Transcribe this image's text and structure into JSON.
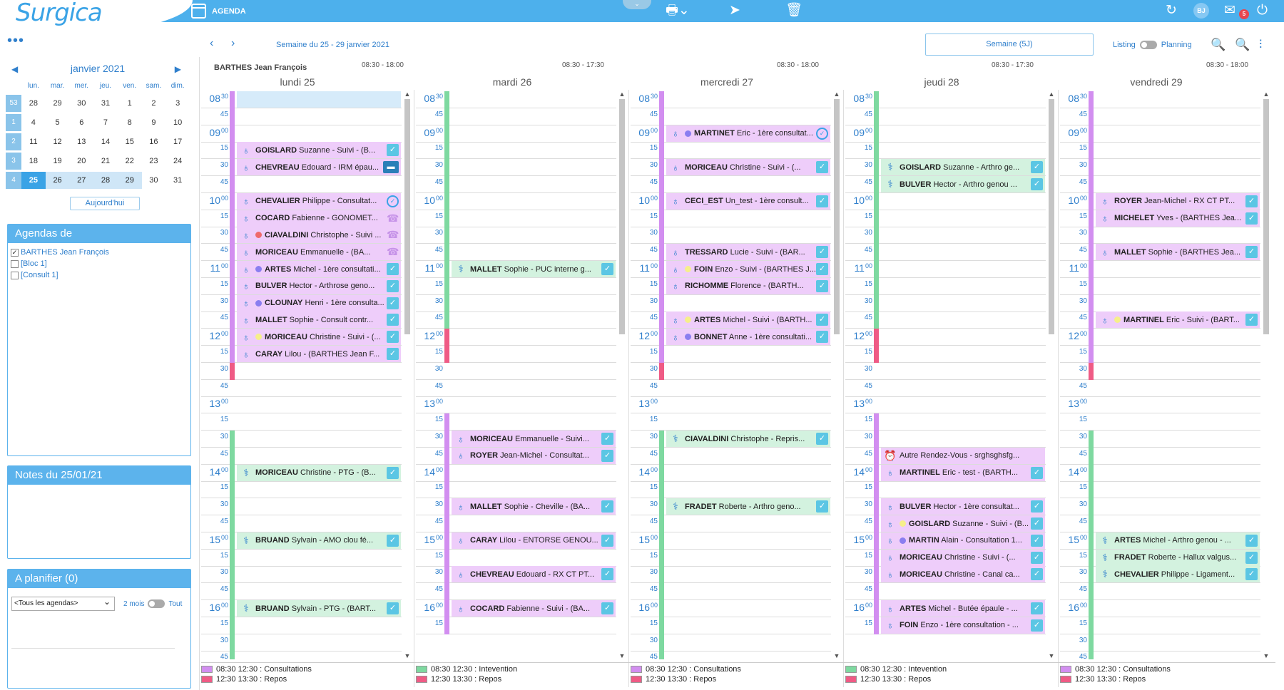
{
  "topbar": {
    "logo": "Surgica",
    "agenda_label": "AGENDA",
    "avatar": "BJ",
    "mail_count": "5",
    "icons": [
      "calendar-icon",
      "print-icon",
      "send-icon",
      "trash-icon",
      "refresh-icon",
      "mail-icon",
      "logout-icon"
    ]
  },
  "week_label": "Semaine du 25 - 29 janvier 2021",
  "week_button": "Semaine (5J)",
  "listing_label": "Listing",
  "planning_label": "Planning",
  "doctor": "BARTHES Jean François",
  "mini_cal": {
    "month": "janvier 2021",
    "dow": [
      "lun.",
      "mar.",
      "mer.",
      "jeu.",
      "ven.",
      "sam.",
      "dim."
    ],
    "weeks": [
      {
        "n": "53",
        "d": [
          "28",
          "29",
          "30",
          "31",
          "1",
          "2",
          "3"
        ]
      },
      {
        "n": "1",
        "d": [
          "4",
          "5",
          "6",
          "7",
          "8",
          "9",
          "10"
        ]
      },
      {
        "n": "2",
        "d": [
          "11",
          "12",
          "13",
          "14",
          "15",
          "16",
          "17"
        ]
      },
      {
        "n": "3",
        "d": [
          "18",
          "19",
          "20",
          "21",
          "22",
          "23",
          "24"
        ]
      },
      {
        "n": "4",
        "d": [
          "25",
          "26",
          "27",
          "28",
          "29",
          "30",
          "31"
        ]
      }
    ],
    "today_btn": "Aujourd'hui"
  },
  "agendas": {
    "title": "Agendas de",
    "items": [
      {
        "label": "BARTHES Jean François",
        "checked": true
      },
      {
        "label": "[Bloc 1]",
        "checked": false
      },
      {
        "label": "[Consult 1]",
        "checked": false
      }
    ]
  },
  "notes": {
    "title": "Notes du 25/01/21"
  },
  "planifier": {
    "title": "A planifier",
    "count": "(0)",
    "select": "<Tous les agendas>",
    "period": "2 mois",
    "all": "Tout"
  },
  "colors": {
    "consult": "#d28ef0",
    "interv": "#7ed9a0",
    "repos": "#ef5b85"
  },
  "days": [
    {
      "hours": "08:30 - 18:00",
      "title": "lundi 25",
      "legend": [
        {
          "c": "#d28ef0",
          "t": "08:30 12:30 : Consultations"
        },
        {
          "c": "#ef5b85",
          "t": "12:30 13:30 : Repos"
        }
      ],
      "end": "17:30",
      "appts": [
        {
          "t": "09:15",
          "name": "GOISLARD",
          "rest": " Suzanne - Suivi -  (B...",
          "st": "✓",
          "kind": "c"
        },
        {
          "t": "09:30",
          "name": "CHEVREAU",
          "rest": " Edouard - IRM épau...",
          "st": "▬",
          "stk": "card",
          "kind": "c"
        },
        {
          "t": "10:00",
          "name": "CHEVALIER",
          "rest": " Philippe - Consultat...",
          "st": "✓",
          "stk": "arr",
          "kind": "c"
        },
        {
          "t": "10:15",
          "name": "COCARD",
          "rest": " Fabienne - GONOMET...",
          "st": "☎",
          "stk": "phone",
          "kind": "c"
        },
        {
          "t": "10:30",
          "name": "CIAVALDINI",
          "rest": " Christophe - Suivi ...",
          "st": "☎",
          "stk": "phone",
          "kind": "c",
          "dot": "#ef6a6a"
        },
        {
          "t": "10:45",
          "name": "MORICEAU",
          "rest": " Emmanuelle -  (BA...",
          "st": "☎",
          "stk": "phone",
          "kind": "c"
        },
        {
          "t": "11:00",
          "name": "ARTES",
          "rest": " Michel - 1ère consultati...",
          "st": "✓",
          "kind": "c",
          "dot": "#8a7ef0"
        },
        {
          "t": "11:15",
          "name": "BULVER",
          "rest": " Hector - Arthrose geno...",
          "st": "✓",
          "kind": "c"
        },
        {
          "t": "11:30",
          "name": "CLOUNAY",
          "rest": " Henri - 1ère consulta...",
          "st": "✓",
          "kind": "c",
          "dot": "#8a7ef0"
        },
        {
          "t": "11:45",
          "name": "MALLET",
          "rest": " Sophie - Consult contr...",
          "st": "✓",
          "kind": "c"
        },
        {
          "t": "12:00",
          "name": "MORICEAU",
          "rest": " Christine - Suivi -  (...",
          "st": "✓",
          "kind": "c",
          "dot": "#f6ef8a"
        },
        {
          "t": "12:15",
          "name": "CARAY",
          "rest": " Lilou -  (BARTHES Jean F...",
          "st": "✓",
          "kind": "c"
        },
        {
          "t": "14:00",
          "name": "MORICEAU",
          "rest": " Christine - PTG -  (B...",
          "st": "✓",
          "kind": "i"
        },
        {
          "t": "15:00",
          "name": "BRUAND",
          "rest": " Sylvain - AMO clou fé...",
          "st": "✓",
          "kind": "i"
        },
        {
          "t": "16:00",
          "name": "BRUAND",
          "rest": " Sylvain - PTG -  (BART...",
          "st": "✓",
          "kind": "i"
        }
      ],
      "bars": [
        {
          "from": "08:30",
          "to": "12:30",
          "c": "#d28ef0"
        },
        {
          "from": "12:30",
          "to": "12:45",
          "c": "#ef5b85"
        },
        {
          "from": "13:30",
          "to": "17:45",
          "c": "#7ed9a0"
        }
      ],
      "hl": "08:30"
    },
    {
      "hours": "08:30 - 17:30",
      "title": "mardi 26",
      "legend": [
        {
          "c": "#7ed9a0",
          "t": "08:30 12:30 : Intevention"
        },
        {
          "c": "#ef5b85",
          "t": "12:30 13:30 : Repos"
        }
      ],
      "end": "16:15",
      "appts": [
        {
          "t": "11:00",
          "name": "MALLET",
          "rest": " Sophie - PUC interne g...",
          "st": "✓",
          "kind": "i"
        },
        {
          "t": "13:30",
          "name": "MORICEAU",
          "rest": " Emmanuelle - Suivi...",
          "st": "✓",
          "kind": "c"
        },
        {
          "t": "13:45",
          "name": "ROYER",
          "rest": " Jean-Michel - Consultat...",
          "st": "✓",
          "kind": "c"
        },
        {
          "t": "14:30",
          "name": "MALLET",
          "rest": " Sophie - Cheville -  (BA...",
          "st": "✓",
          "kind": "c"
        },
        {
          "t": "15:00",
          "name": "CARAY",
          "rest": " Lilou - ENTORSE GENOU...",
          "st": "✓",
          "kind": "c"
        },
        {
          "t": "15:30",
          "name": "CHEVREAU",
          "rest": " Edouard - RX CT PT...",
          "st": "✓",
          "kind": "c"
        },
        {
          "t": "16:00",
          "name": "COCARD",
          "rest": " Fabienne - Suivi -  (BA...",
          "st": "✓",
          "kind": "c"
        }
      ],
      "bars": [
        {
          "from": "08:30",
          "to": "12:00",
          "c": "#7ed9a0"
        },
        {
          "from": "12:00",
          "to": "12:30",
          "c": "#ef5b85"
        },
        {
          "from": "13:15",
          "to": "16:30",
          "c": "#d28ef0"
        }
      ]
    },
    {
      "hours": "08:30 - 18:00",
      "title": "mercredi 27",
      "legend": [
        {
          "c": "#d28ef0",
          "t": "08:30 12:30 : Consultations"
        },
        {
          "c": "#ef5b85",
          "t": "12:30 13:30 : Repos"
        }
      ],
      "end": "17:30",
      "appts": [
        {
          "t": "09:00",
          "name": "MARTINET",
          "rest": " Eric - 1ère consultat...",
          "st": "✓",
          "stk": "arr",
          "kind": "c",
          "dot": "#8a7ef0"
        },
        {
          "t": "09:30",
          "name": "MORICEAU",
          "rest": " Christine - Suivi -  (...",
          "st": "✓",
          "kind": "c"
        },
        {
          "t": "10:00",
          "name": "CECI_EST",
          "rest": " Un_test - 1ère consult...",
          "st": "✓",
          "kind": "c"
        },
        {
          "t": "10:45",
          "name": "TRESSARD",
          "rest": " Lucie - Suivi -  (BAR...",
          "st": "✓",
          "kind": "c"
        },
        {
          "t": "11:00",
          "name": "FOIN",
          "rest": " Enzo - Suivi -  (BARTHES J...",
          "st": "✓",
          "kind": "c",
          "dot": "#f6ef8a"
        },
        {
          "t": "11:15",
          "name": "RICHOMME",
          "rest": " Florence -  (BARTH...",
          "st": "✓",
          "kind": "c"
        },
        {
          "t": "11:45",
          "name": "ARTES",
          "rest": " Michel - Suivi -  (BARTH...",
          "st": "✓",
          "kind": "c",
          "dot": "#f6ef8a"
        },
        {
          "t": "12:00",
          "name": "BONNET",
          "rest": " Anne - 1ère consultati...",
          "st": "✓",
          "kind": "c",
          "dot": "#8a7ef0"
        },
        {
          "t": "13:30",
          "name": "CIAVALDINI",
          "rest": " Christophe - Repris...",
          "st": "✓",
          "kind": "i"
        },
        {
          "t": "14:30",
          "name": "FRADET",
          "rest": " Roberte - Arthro geno...",
          "st": "✓",
          "kind": "i"
        }
      ],
      "bars": [
        {
          "from": "08:30",
          "to": "12:30",
          "c": "#d28ef0"
        },
        {
          "from": "12:30",
          "to": "12:45",
          "c": "#ef5b85"
        },
        {
          "from": "13:30",
          "to": "17:45",
          "c": "#7ed9a0"
        }
      ]
    },
    {
      "hours": "08:30 - 17:30",
      "title": "jeudi 28",
      "legend": [
        {
          "c": "#7ed9a0",
          "t": "08:30 12:30 : Intevention"
        },
        {
          "c": "#ef5b85",
          "t": "12:30 13:30 : Repos"
        }
      ],
      "end": "16:15",
      "appts": [
        {
          "t": "09:30",
          "name": "GOISLARD",
          "rest": " Suzanne - Arthro ge...",
          "st": "✓",
          "kind": "i"
        },
        {
          "t": "09:45",
          "name": "BULVER",
          "rest": " Hector - Arthro genou ...",
          "st": "✓",
          "kind": "i"
        },
        {
          "t": "13:45",
          "name": "Autre Rendez-Vous",
          "rest": " - srghsghsfg...",
          "st": "",
          "kind": "c",
          "plain": true,
          "clock": true
        },
        {
          "t": "14:00",
          "name": "MARTINEL",
          "rest": " Eric - test -  (BARTH...",
          "st": "✓",
          "kind": "c"
        },
        {
          "t": "14:30",
          "name": "BULVER",
          "rest": " Hector - 1ère consultat...",
          "st": "✓",
          "kind": "c"
        },
        {
          "t": "14:45",
          "name": "GOISLARD",
          "rest": " Suzanne - Suivi -  (B...",
          "st": "✓",
          "kind": "c",
          "dot": "#f6ef8a"
        },
        {
          "t": "15:00",
          "name": "MARTIN",
          "rest": " Alain - Consultation 1...",
          "st": "✓",
          "kind": "c",
          "dot": "#8a7ef0"
        },
        {
          "t": "15:15",
          "name": "MORICEAU",
          "rest": " Christine - Suivi -  (...",
          "st": "✓",
          "kind": "c"
        },
        {
          "t": "15:30",
          "name": "MORICEAU",
          "rest": " Christine - Canal ca...",
          "st": "✓",
          "kind": "c"
        },
        {
          "t": "16:00",
          "name": "ARTES",
          "rest": " Michel - Butée épaule - ...",
          "st": "✓",
          "kind": "c"
        },
        {
          "t": "16:15",
          "name": "FOIN",
          "rest": " Enzo - 1ère consultation - ...",
          "st": "✓",
          "kind": "c"
        }
      ],
      "bars": [
        {
          "from": "08:30",
          "to": "12:00",
          "c": "#7ed9a0"
        },
        {
          "from": "12:00",
          "to": "12:30",
          "c": "#ef5b85"
        },
        {
          "from": "13:15",
          "to": "16:30",
          "c": "#d28ef0"
        }
      ]
    },
    {
      "hours": "08:30 - 18:00",
      "title": "vendredi 29",
      "legend": [
        {
          "c": "#d28ef0",
          "t": "08:30 12:30 : Consultations"
        },
        {
          "c": "#ef5b85",
          "t": "12:30 13:30 : Repos"
        }
      ],
      "end": "17:30",
      "appts": [
        {
          "t": "10:00",
          "name": "ROYER",
          "rest": " Jean-Michel - RX CT PT...",
          "st": "✓",
          "kind": "c"
        },
        {
          "t": "10:15",
          "name": "MICHELET",
          "rest": " Yves -  (BARTHES Jea...",
          "st": "✓",
          "kind": "c"
        },
        {
          "t": "10:45",
          "name": "MALLET",
          "rest": " Sophie -  (BARTHES Jea...",
          "st": "✓",
          "kind": "c"
        },
        {
          "t": "11:45",
          "name": "MARTINEL",
          "rest": " Eric - Suivi -  (BART...",
          "st": "✓",
          "kind": "c",
          "dot": "#f6ef8a"
        },
        {
          "t": "15:00",
          "name": "ARTES",
          "rest": " Michel - Arthro genou - ...",
          "st": "✓",
          "kind": "i"
        },
        {
          "t": "15:15",
          "name": "FRADET",
          "rest": " Roberte - Hallux valgus...",
          "st": "✓",
          "kind": "i"
        },
        {
          "t": "15:30",
          "name": "CHEVALIER",
          "rest": " Philippe - Ligament...",
          "st": "✓",
          "kind": "i"
        }
      ],
      "bars": [
        {
          "from": "08:30",
          "to": "12:30",
          "c": "#d28ef0"
        },
        {
          "from": "12:30",
          "to": "12:45",
          "c": "#ef5b85"
        },
        {
          "from": "13:30",
          "to": "17:45",
          "c": "#7ed9a0"
        }
      ]
    }
  ]
}
